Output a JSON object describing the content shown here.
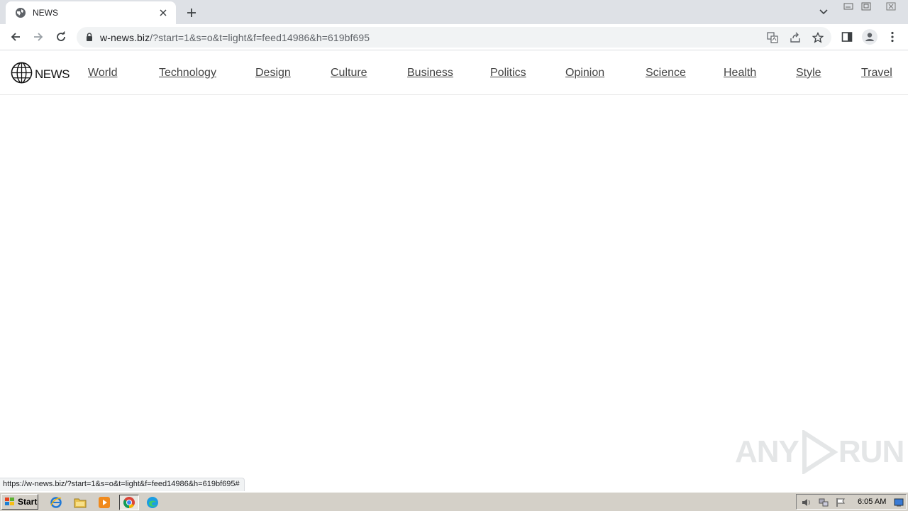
{
  "browser": {
    "tab": {
      "title": "NEWS",
      "favicon": "globe-icon"
    },
    "address": {
      "host": "w-news.biz",
      "path": "/?start=1&s=o&t=light&f=feed14986&h=619bf695"
    },
    "status_url": "https://w-news.biz/?start=1&s=o&t=light&f=feed14986&h=619bf695#"
  },
  "site": {
    "logo_text": "NEWS",
    "nav": [
      "World",
      "Technology",
      "Design",
      "Culture",
      "Business",
      "Politics",
      "Opinion",
      "Science",
      "Health",
      "Style",
      "Travel"
    ]
  },
  "watermark": {
    "left": "ANY",
    "right": "RUN"
  },
  "taskbar": {
    "start_label": "Start",
    "clock": "6:05 AM",
    "apps": [
      "ie-icon",
      "folder-icon",
      "media-player-icon",
      "chrome-icon",
      "edge-icon"
    ]
  },
  "colors": {
    "tabstrip": "#dee1e6",
    "nav_text": "#444444",
    "taskbar": "#d4d0c8"
  }
}
